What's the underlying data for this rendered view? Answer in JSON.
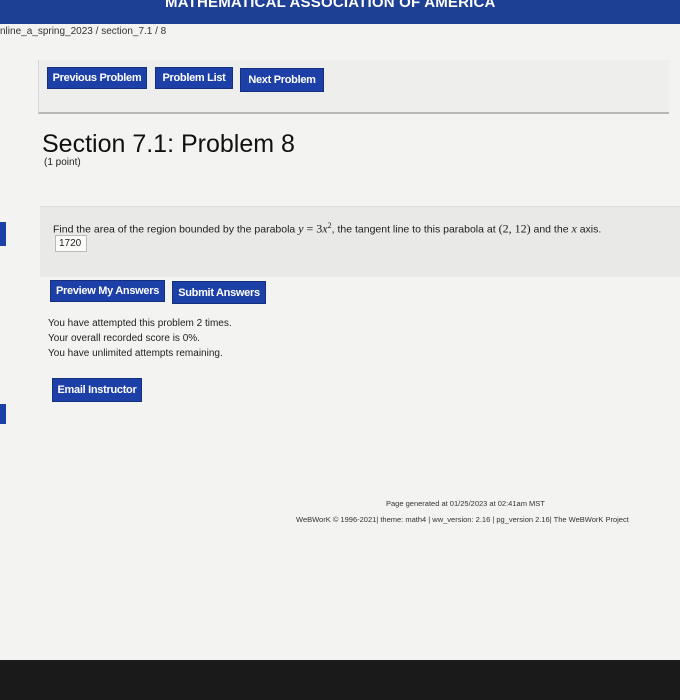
{
  "banner": {
    "text": "MATHEMATICAL ASSOCIATION OF AMERICA"
  },
  "breadcrumb": {
    "text": "nline_a_spring_2023 / section_7.1 / 8"
  },
  "nav": {
    "previous_label": "Previous Problem",
    "list_label": "Problem List",
    "next_label": "Next Problem"
  },
  "problem": {
    "title": "Section 7.1: Problem 8",
    "points": "(1 point)",
    "text_before": "Find the area of the region bounded by the parabola ",
    "math_y": "y",
    "math_eq": " = 3",
    "math_x": "x",
    "math_sup": "2",
    "text_mid": ", the tangent line to this parabola at ",
    "math_point": "(2, 12)",
    "text_after": " and the ",
    "math_axis": "x",
    "text_end": " axis.",
    "answer_value": "1720"
  },
  "actions": {
    "preview_label": "Preview My Answers",
    "submit_label": "Submit Answers",
    "email_label": "Email Instructor"
  },
  "attempts": {
    "line1": "You have attempted this problem 2 times.",
    "line2": "Your overall recorded score is 0%.",
    "line3": "You have unlimited attempts remaining."
  },
  "footer": {
    "generated": "Page generated at 01/25/2023 at 02:41am MST",
    "copyright": "WeBWorK © 1996-2021| theme: math4 | ww_version: 2.16 | pg_version 2.16| The WeBWorK Project"
  },
  "colors": {
    "accent": "#1d40a8",
    "banner": "#1d3f94"
  }
}
